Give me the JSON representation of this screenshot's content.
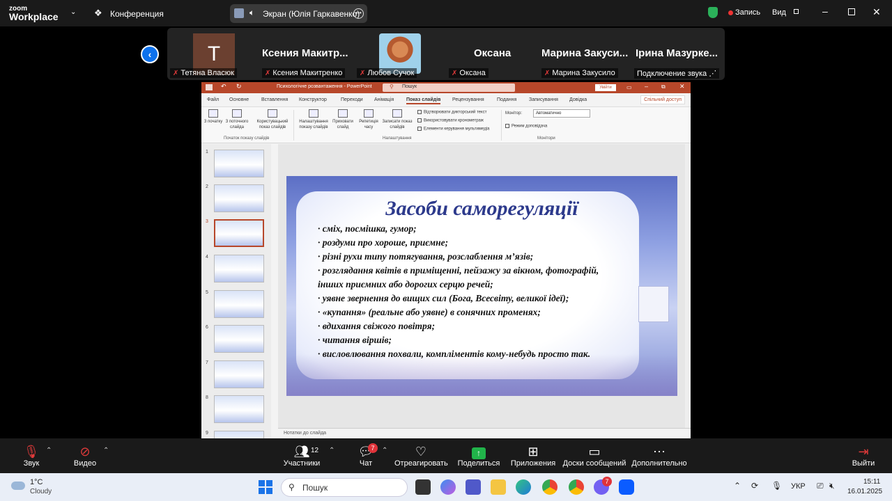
{
  "zoom": {
    "logo_top": "zoom",
    "logo_bottom": "Workplace",
    "conference_label": "Конференция",
    "screen_share_label": "Экран (Юлія Гаркавенко)",
    "record_label": "Запись",
    "view_label": "Вид"
  },
  "participants": [
    {
      "initial": "T",
      "label": "Тетяна Власюк",
      "muted": true
    },
    {
      "big_name": "Ксения  Макитр...",
      "label": "Ксения Макитренко",
      "muted": true
    },
    {
      "label": "Любов Сучок",
      "muted": true
    },
    {
      "big_name": "Оксана",
      "label": "Оксана",
      "muted": true
    },
    {
      "big_name": "Марина  Закуси...",
      "label": "Марина Закусило",
      "muted": true
    },
    {
      "big_name": "Ірина  Мазурке...",
      "label": "Подключение звука",
      "muted": false
    }
  ],
  "ppt": {
    "title": "Психологічне розвантаження  -  PowerPoint",
    "search_placeholder": "Пошук",
    "signin": "Увійти",
    "share": "Спільний доступ",
    "tabs": [
      "Файл",
      "Основне",
      "Вставлення",
      "Конструктор",
      "Переходи",
      "Анімація",
      "Показ слайдів",
      "Рецензування",
      "Подання",
      "Записування",
      "Довідка"
    ],
    "active_tab": "Показ слайдів",
    "ribbon": {
      "btn_from_start": "З початку",
      "btn_from_current": "З поточного слайда",
      "btn_custom": "Користувацький показ слайдів",
      "group_start": "Початок показу слайдів",
      "btn_setup": "Налаштування показу слайдів",
      "btn_hide": "Приховати слайд",
      "btn_rehearse": "Репетиція часу",
      "btn_record": "Записати показ слайдів",
      "chk_narration": "Відтворювати дикторський текст",
      "chk_timings": "Використовувати кронометраж",
      "chk_media": "Елементи керування мультимедіа",
      "group_setup": "Налаштування",
      "monitor_label": "Монітор:",
      "monitor_value": "Автоматично",
      "presenter_view": "Режим доповідача",
      "group_monitors": "Монітори"
    },
    "slide_numbers": [
      "1",
      "2",
      "3",
      "4",
      "5",
      "6",
      "7",
      "8",
      "9"
    ],
    "selected_slide": "3",
    "notes_label": "Нотатки до слайда",
    "slide": {
      "title": "Засоби саморегуляції",
      "bullets": [
        "· сміх, посмішка, гумор;",
        "· роздуми про хороше, приємне;",
        "· різні рухи типу потягування, розслаблення м’язів;",
        "· розглядання квітів в приміщенні, пейзажу за вікном, фотографій,",
        "інших приємних або дорогих серцю речей;",
        "· уявне звернення до вищих сил (Бога, Всесвіту, великої ідеї);",
        "· «купання» (реальне або уявне) в сонячних променях;",
        "· вдихання свіжого повітря;",
        "· читання віршів;",
        "· висловлювання похвали, компліментів кому-небудь просто так."
      ]
    }
  },
  "toolbar": {
    "audio": "Звук",
    "video": "Видео",
    "participants": "Участники",
    "participants_count": "12",
    "chat": "Чат",
    "chat_badge": "7",
    "react": "Отреагировать",
    "share": "Поделиться",
    "apps": "Приложения",
    "whiteboards": "Доски сообщений",
    "more": "Дополнительно",
    "leave": "Выйти"
  },
  "taskbar": {
    "temp": "1°C",
    "weather": "Cloudy",
    "search": "Пошук",
    "lang": "УКР",
    "time": "15:11",
    "date": "16.01.2025",
    "viber_badge": "7"
  }
}
